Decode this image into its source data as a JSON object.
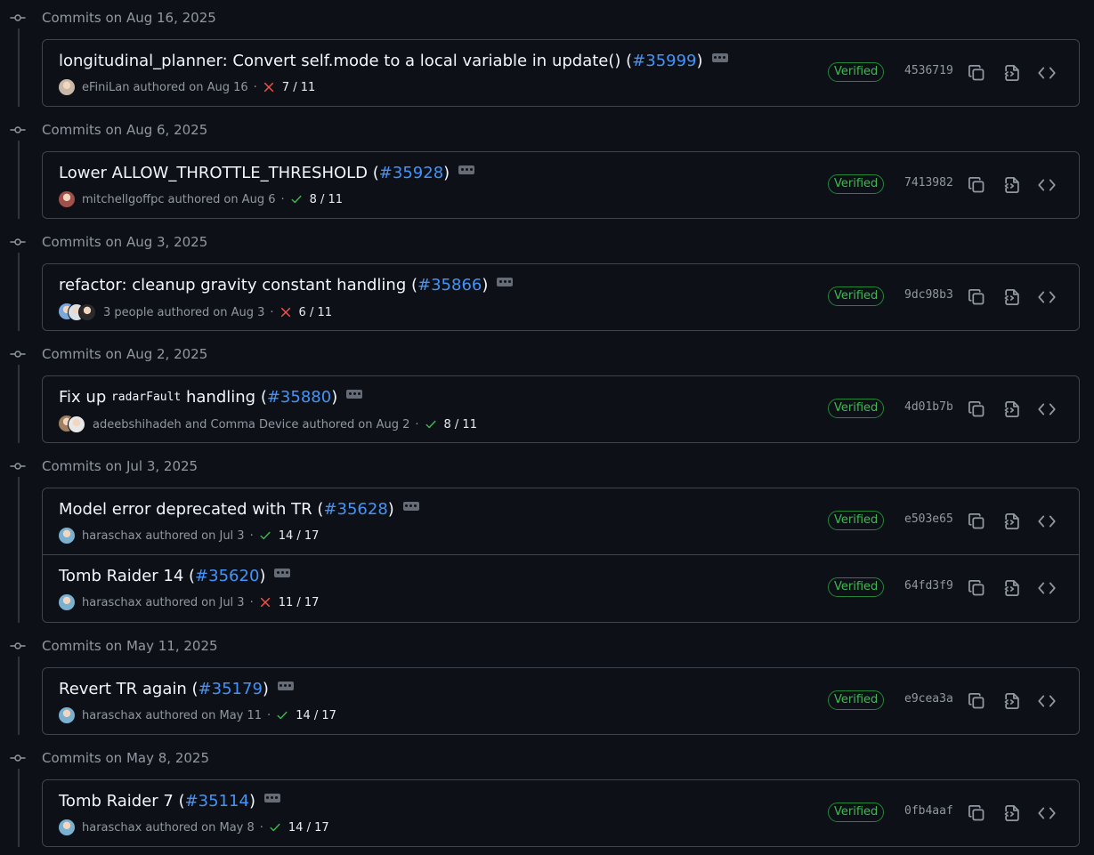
{
  "groups": [
    {
      "date_label": "Commits on Aug 16, 2025",
      "commits": [
        {
          "title_before": "longitudinal_planner: Convert self.mode to a local variable in update() (",
          "pr": "#35999",
          "title_after": ")",
          "authors": "eFiniLan",
          "authored_label": "authored",
          "date": "on Aug 16",
          "status": "fail",
          "checks": "7 / 11",
          "verified": "Verified",
          "sha": "4536719",
          "avatar_colors": [
            "#c8b8a8"
          ]
        }
      ]
    },
    {
      "date_label": "Commits on Aug 6, 2025",
      "commits": [
        {
          "title_before": "Lower ALLOW_THROTTLE_THRESHOLD (",
          "pr": "#35928",
          "title_after": ")",
          "authors": "mitchellgoffpc",
          "authored_label": "authored",
          "date": "on Aug 6",
          "status": "pass",
          "checks": "8 / 11",
          "verified": "Verified",
          "sha": "7413982",
          "avatar_colors": [
            "#a0504a"
          ]
        }
      ]
    },
    {
      "date_label": "Commits on Aug 3, 2025",
      "commits": [
        {
          "title_before": "refactor: cleanup gravity constant handling (",
          "pr": "#35866",
          "title_after": ")",
          "authors": "3 people",
          "authored_label": "authored",
          "date": "on Aug 3",
          "status": "fail",
          "checks": "6 / 11",
          "verified": "Verified",
          "sha": "9dc98b3",
          "avatar_colors": [
            "#7aa8d8",
            "#d8e0e8",
            "#2a2a2a"
          ]
        }
      ]
    },
    {
      "date_label": "Commits on Aug 2, 2025",
      "commits": [
        {
          "title_before": "Fix up ",
          "code": "radarFault",
          "title_mid": " handling (",
          "pr": "#35880",
          "title_after": ")",
          "authors": "adeebshihadeh and Comma Device",
          "authored_label": "authored",
          "date": "on Aug 2",
          "status": "pass",
          "checks": "8 / 11",
          "verified": "Verified",
          "sha": "4d01b7b",
          "avatar_colors": [
            "#a08060",
            "#e8e8e8"
          ]
        }
      ]
    },
    {
      "date_label": "Commits on Jul 3, 2025",
      "commits": [
        {
          "title_before": "Model error deprecated with TR (",
          "pr": "#35628",
          "title_after": ")",
          "authors": "haraschax",
          "authored_label": "authored",
          "date": "on Jul 3",
          "status": "pass",
          "checks": "14 / 17",
          "verified": "Verified",
          "sha": "e503e65",
          "avatar_colors": [
            "#7ab0d0"
          ]
        },
        {
          "title_before": "Tomb Raider 14 (",
          "pr": "#35620",
          "title_after": ")",
          "authors": "haraschax",
          "authored_label": "authored",
          "date": "on Jul 3",
          "status": "fail",
          "checks": "11 / 17",
          "verified": "Verified",
          "sha": "64fd3f9",
          "avatar_colors": [
            "#7ab0d0"
          ]
        }
      ]
    },
    {
      "date_label": "Commits on May 11, 2025",
      "commits": [
        {
          "title_before": "Revert TR again (",
          "pr": "#35179",
          "title_after": ")",
          "authors": "haraschax",
          "authored_label": "authored",
          "date": "on May 11",
          "status": "pass",
          "checks": "14 / 17",
          "verified": "Verified",
          "sha": "e9cea3a",
          "avatar_colors": [
            "#7ab0d0"
          ]
        }
      ]
    },
    {
      "date_label": "Commits on May 8, 2025",
      "commits": [
        {
          "title_before": "Tomb Raider 7 (",
          "pr": "#35114",
          "title_after": ")",
          "authors": "haraschax",
          "authored_label": "authored",
          "date": "on May 8",
          "status": "pass",
          "checks": "14 / 17",
          "verified": "Verified",
          "sha": "0fb4aaf",
          "avatar_colors": [
            "#7ab0d0"
          ]
        }
      ]
    }
  ],
  "colors": {
    "pass": "#3fb950",
    "fail": "#f85149",
    "link": "#4493f8"
  },
  "icons": {
    "group": "git-commit-icon",
    "pass": "check-icon",
    "fail": "x-icon",
    "copy": "copy-icon",
    "browse": "file-code-icon",
    "code": "code-icon",
    "more": "ellipsis-icon"
  }
}
